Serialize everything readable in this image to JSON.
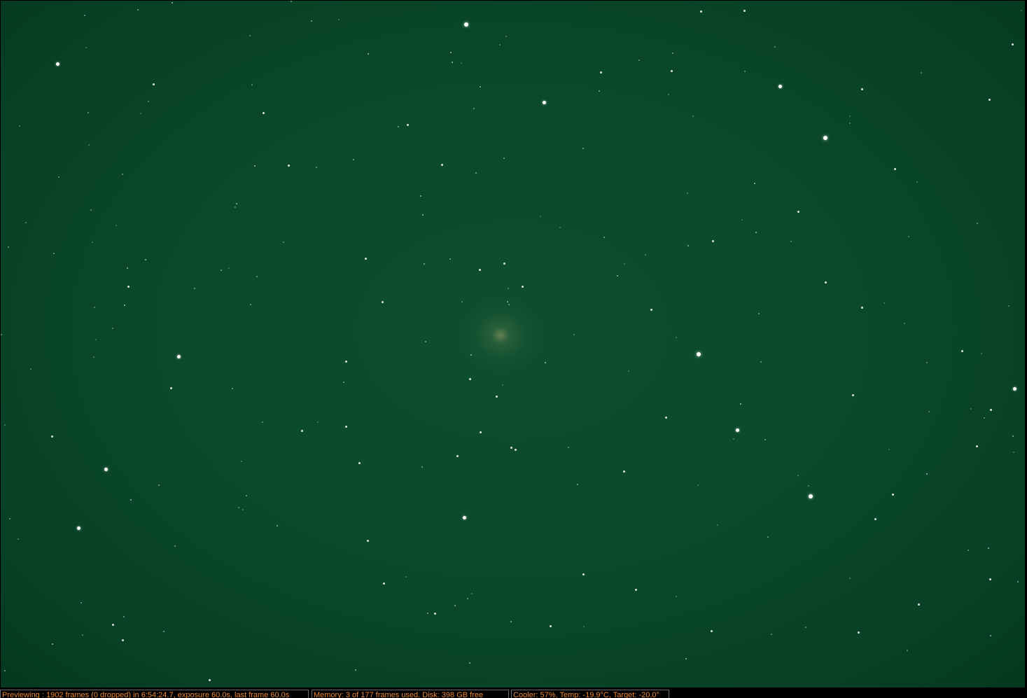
{
  "preview": {
    "background_color": "#0b4a2b",
    "star_color": "#ffffff"
  },
  "statusbar": {
    "text_color": "#e8862e",
    "preview_status": "Previewing : 1902 frames (0 dropped) in 6:54:24.7, exposure 60.0s, last frame 60.0s",
    "memory_status": "Memory: 3 of 177 frames used. Disk: 398 GB free",
    "cooler_status": "Cooler: 57%, Temp: -19.9°C, Target: -20.0°"
  }
}
